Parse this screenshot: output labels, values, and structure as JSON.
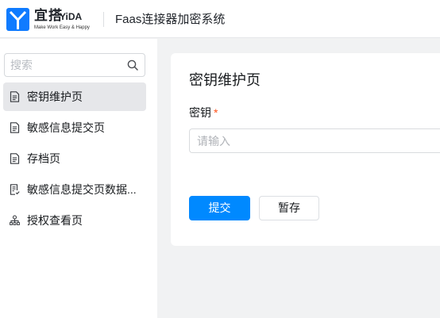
{
  "header": {
    "brand_cn": "宜搭",
    "brand_en": "YiDA",
    "slogan": "Make Work Easy & Happy",
    "app_title": "Faas连接器加密系统",
    "logo_icon": "yida-logo-icon"
  },
  "sidebar": {
    "search_placeholder": "搜索",
    "search_icon": "search-icon",
    "items": [
      {
        "label": "密钥维护页",
        "icon": "document-icon",
        "selected": true
      },
      {
        "label": "敏感信息提交页",
        "icon": "document-icon",
        "selected": false
      },
      {
        "label": "存档页",
        "icon": "document-icon",
        "selected": false
      },
      {
        "label": "敏感信息提交页数据...",
        "icon": "document-list-icon",
        "selected": false
      },
      {
        "label": "授权查看页",
        "icon": "org-tree-icon",
        "selected": false
      }
    ]
  },
  "form": {
    "title": "密钥维护页",
    "field_label": "密钥",
    "required_mark": "*",
    "input_placeholder": "请输入",
    "submit_label": "提交",
    "save_draft_label": "暂存"
  },
  "colors": {
    "primary": "#0089ff",
    "required": "#ff5219",
    "selected_bg": "#e6e7ea",
    "page_bg": "#f1f2f3"
  }
}
